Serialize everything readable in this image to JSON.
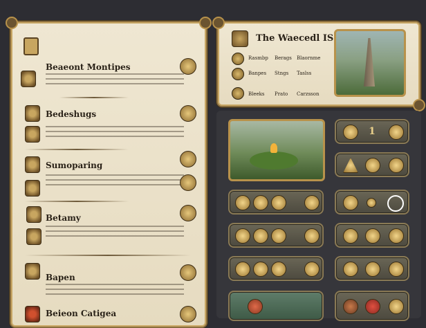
{
  "book": {
    "sections": [
      {
        "title": "Beaeont Montipes"
      },
      {
        "title": "Bedeshugs"
      },
      {
        "title": "Sumoparing"
      },
      {
        "title": "Betamy"
      },
      {
        "title": "Bapen"
      },
      {
        "title": "Beieon Catigea"
      }
    ]
  },
  "world": {
    "title": "The Waecedl IS",
    "stats": [
      {
        "label": "Rasmbp"
      },
      {
        "label": "Berags"
      },
      {
        "label": "Blaornme"
      },
      {
        "label": "Banpes"
      },
      {
        "label": "Stngs"
      },
      {
        "label": "Taslss"
      },
      {
        "label": "Bleeks"
      },
      {
        "label": "Prato"
      },
      {
        "label": "Carzsson"
      }
    ]
  },
  "slots": {
    "counter": "1"
  },
  "colors": {
    "parchment": "#efe7d2",
    "gold": "#c9a865",
    "slot": "#5a5749",
    "background": "#2d2d33"
  }
}
